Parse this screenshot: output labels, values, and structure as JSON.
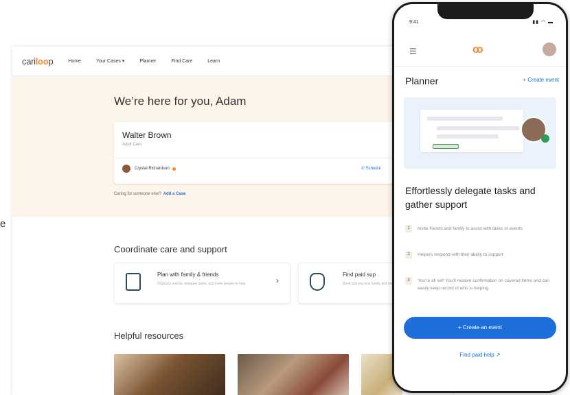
{
  "page_edge_char": "e",
  "desktop": {
    "logo": {
      "pre": "cari",
      "accent": "loo",
      "post": "p"
    },
    "nav": [
      "Home",
      "Your Cases",
      "Planner",
      "Find Care",
      "Learn"
    ],
    "greeting": "We’re here for you, Adam",
    "case": {
      "name": "Walter Brown",
      "type": "Adult Care",
      "caregiver": "Crystal Richardson",
      "schedule_label": "Schedul"
    },
    "add_case": {
      "prompt": "Caring for someone else?",
      "link": "Add a Case"
    },
    "coordinate": {
      "title": "Coordinate care and support",
      "tiles": [
        {
          "title": "Plan with family & friends",
          "desc": "Organize events, delegate tasks, and invite people to help"
        },
        {
          "title": "Find paid sup",
          "desc": "Book and pay trus family and house"
        }
      ]
    },
    "resources_title": "Helpful resources"
  },
  "phone": {
    "time": "9:41",
    "brand_mark": "oo",
    "title": "Planner",
    "create_top": "+ Create event",
    "headline": "Effortlessly delegate tasks and gather support",
    "steps": [
      {
        "num": "1",
        "text": "Invite friends and family to assist with tasks or events"
      },
      {
        "num": "2",
        "text": "Helpers respond with their ability to support"
      },
      {
        "num": "3",
        "text": "You’re all set! You’ll receive confirmation on covered items and can easily keep record of who is helping."
      }
    ],
    "cta": "+ Create an event",
    "find_help": "Find paid help ↗"
  }
}
